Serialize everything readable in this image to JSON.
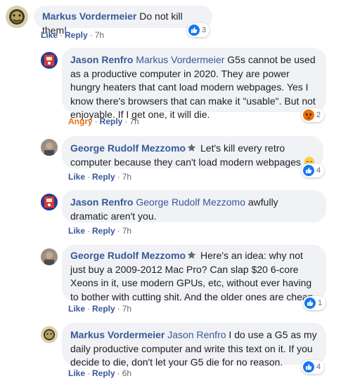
{
  "comments": [
    {
      "author": "Markus Vordermeier",
      "text": "Do not kill them!",
      "actions": {
        "like": "Like",
        "reply": "Reply",
        "time": "7h"
      },
      "reaction_count": "3",
      "reaction_type": "like"
    },
    {
      "author": "Jason Renfro",
      "mention": "Markus Vordermeier",
      "text": "G5s cannot be used as a productive computer in 2020. They are power hungry heaters that cant load modern webpages. Yes I know there's browsers that can make it \"usable\". But not enjoyable. If I get one, it will die.",
      "actions": {
        "like": "Angry",
        "reply": "Reply",
        "time": "7h"
      },
      "reaction_count": "2",
      "reaction_type": "angry"
    },
    {
      "author": "George Rudolf Mezzomo",
      "text": "Let's kill every retro computer because they can't load modern webpages",
      "actions": {
        "like": "Like",
        "reply": "Reply",
        "time": "7h"
      },
      "reaction_count": "4",
      "reaction_type": "like"
    },
    {
      "author": "Jason Renfro",
      "mention": "George Rudolf Mezzomo",
      "text": "awfully dramatic aren't you.",
      "actions": {
        "like": "Like",
        "reply": "Reply",
        "time": "7h"
      }
    },
    {
      "author": "George Rudolf Mezzomo",
      "text": "Here's an idea: why not just buy a 2009-2012 Mac Pro? Can slap $20 6-core Xeons in it, use modern GPUs, etc, without ever having to bother with cutting shit. And the older ones are cheap.",
      "actions": {
        "like": "Like",
        "reply": "Reply",
        "time": "7h"
      },
      "reaction_count": "1",
      "reaction_type": "like"
    },
    {
      "author": "Markus Vordermeier",
      "mention": "Jason Renfro",
      "text": "I do use a G5 as my daily productive computer and write this text on it. If you decide to die, don't let your G5 die for no reason.",
      "actions": {
        "like": "Like",
        "reply": "Reply",
        "time": "6h"
      },
      "reaction_count": "4",
      "reaction_type": "like"
    }
  ],
  "colors": {
    "link": "#385898",
    "bubble": "#f0f2f5",
    "like": "#1877f2",
    "angry": "#e9710f"
  },
  "icons": {
    "like": "thumbs-up-icon",
    "angry": "angry-face-icon",
    "badge": "top-fan-star-icon",
    "emoji": "relieved-face-emoji-icon"
  }
}
